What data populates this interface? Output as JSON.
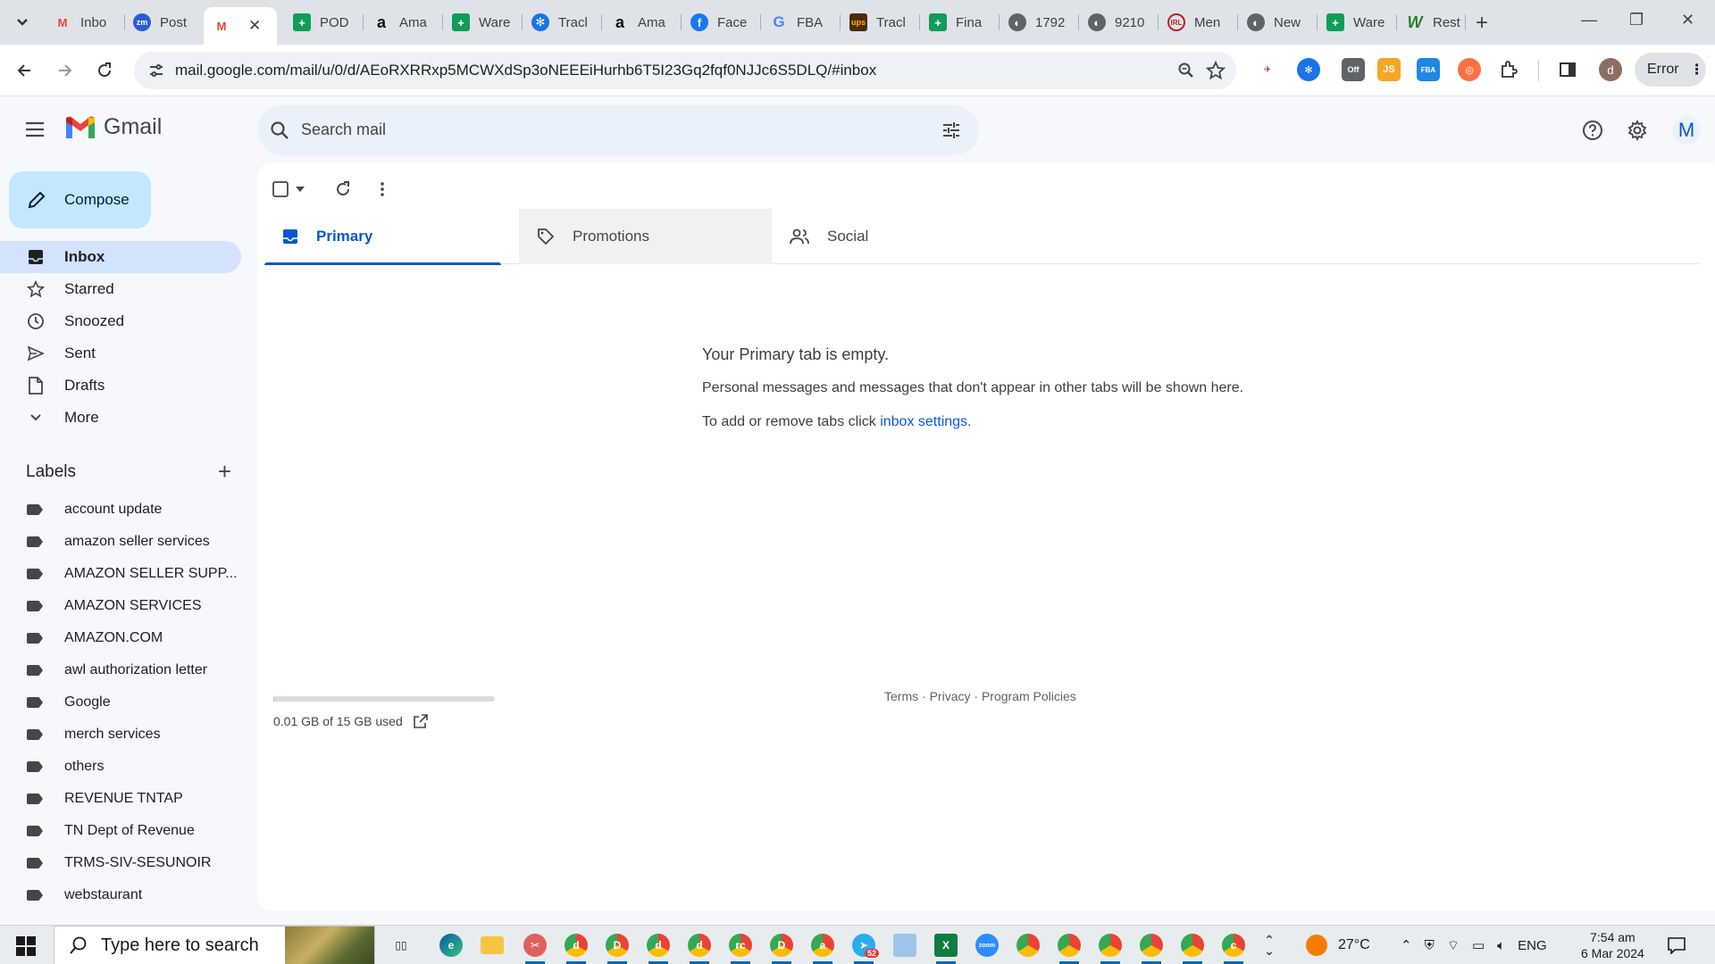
{
  "browser": {
    "tabs": [
      {
        "label": "Inbo",
        "icon": "gmail-icon"
      },
      {
        "label": "Post",
        "icon": "zm-icon"
      },
      {
        "label": "",
        "icon": "gmail-icon",
        "active": true
      },
      {
        "label": "POD",
        "icon": "sheets-icon"
      },
      {
        "label": "Ama",
        "icon": "amazon-icon"
      },
      {
        "label": "Ware",
        "icon": "sheets-icon"
      },
      {
        "label": "Tracl",
        "icon": "globe-icon"
      },
      {
        "label": "Ama",
        "icon": "amazon-icon"
      },
      {
        "label": "Face",
        "icon": "facebook-icon"
      },
      {
        "label": "FBA",
        "icon": "google-icon"
      },
      {
        "label": "Tracl",
        "icon": "ups-icon"
      },
      {
        "label": "Fina",
        "icon": "sheets-icon"
      },
      {
        "label": "1792",
        "icon": "globe-icon"
      },
      {
        "label": "9210",
        "icon": "globe-icon"
      },
      {
        "label": "Men",
        "icon": "site-icon"
      },
      {
        "label": "New",
        "icon": "globe-icon"
      },
      {
        "label": "Ware",
        "icon": "sheets-icon"
      },
      {
        "label": "Rest",
        "icon": "site-icon"
      }
    ],
    "url": "mail.google.com/mail/u/0/d/AEoRXRRxp5MCWXdSp3oNEEEiHurhb6T5I23Gq2fqf0NJJc6S5DLQ/#inbox",
    "error_label": "Error",
    "extension_badge": "Off",
    "ext_labels": [
      "JS",
      "FBA"
    ]
  },
  "gmail": {
    "brand": "Gmail",
    "search_placeholder": "Search mail",
    "avatar_letter": "M",
    "compose_label": "Compose",
    "nav": [
      {
        "label": "Inbox",
        "icon": "inbox-icon",
        "active": true
      },
      {
        "label": "Starred",
        "icon": "star-icon"
      },
      {
        "label": "Snoozed",
        "icon": "clock-icon"
      },
      {
        "label": "Sent",
        "icon": "send-icon"
      },
      {
        "label": "Drafts",
        "icon": "draft-icon"
      },
      {
        "label": "More",
        "icon": "chevron-down-icon"
      }
    ],
    "labels_title": "Labels",
    "labels": [
      "account update",
      "amazon seller services",
      "AMAZON SELLER SUPP...",
      "AMAZON SERVICES",
      "AMAZON.COM",
      "awl authorization letter",
      "Google",
      "merch services",
      "others",
      "REVENUE TNTAP",
      "TN Dept of Revenue",
      "TRMS-SIV-SESUNOIR",
      "webstaurant"
    ],
    "category_tabs": [
      {
        "label": "Primary",
        "icon": "inbox-icon",
        "selected": true
      },
      {
        "label": "Promotions",
        "icon": "tag-icon"
      },
      {
        "label": "Social",
        "icon": "people-icon"
      }
    ],
    "empty_title": "Your Primary tab is empty.",
    "empty_desc": "Personal messages and messages that don't appear in other tabs will be shown here.",
    "empty_hint_prefix": "To add or remove tabs click ",
    "empty_hint_link": "inbox settings",
    "empty_hint_suffix": ".",
    "storage_text": "0.01 GB of 15 GB used",
    "storage_fraction": 0.001,
    "footer": {
      "terms": "Terms",
      "sep": " · ",
      "privacy": "Privacy",
      "policies": "Program Policies"
    }
  },
  "taskbar": {
    "search_placeholder": "Type here to search",
    "telegram_badge": "52",
    "zoom_label": "zoom",
    "profile_letters": [
      "d",
      "D",
      "d",
      "d",
      "rc",
      "D",
      "a",
      "c"
    ],
    "temperature": "27°C",
    "language": "ENG",
    "time": "7:54 am",
    "date": "6 Mar 2024"
  },
  "colors": {
    "accent": "#0b57d0",
    "compose_bg": "#c2e7ff",
    "nav_active_bg": "#d3e3fd",
    "search_bg": "#eaf1fb"
  }
}
